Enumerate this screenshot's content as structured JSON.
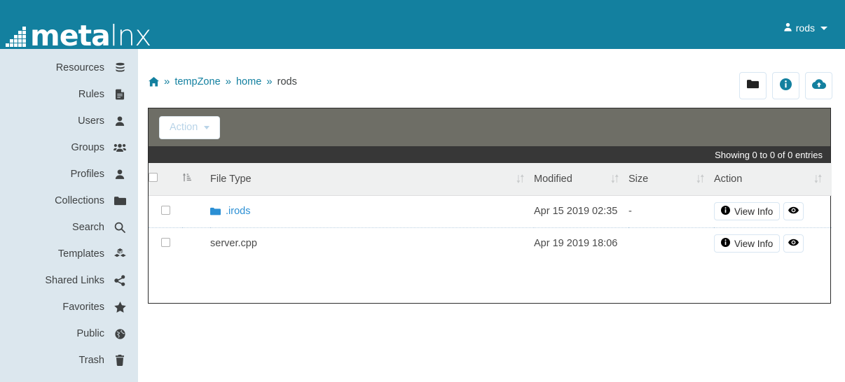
{
  "brand": {
    "name_bold": "meta",
    "name_light": "lnx",
    "header_color": "#13809f"
  },
  "header": {
    "user_label": "rods",
    "user_icon": "user-icon",
    "caret_icon": "caret-down-icon"
  },
  "sidebar": {
    "bg_color": "#dce7ee",
    "items": [
      {
        "label": "Resources",
        "icon": "database-icon"
      },
      {
        "label": "Rules",
        "icon": "file-text-icon"
      },
      {
        "label": "Users",
        "icon": "user-icon"
      },
      {
        "label": "Groups",
        "icon": "users-group-icon"
      },
      {
        "label": "Profiles",
        "icon": "user-icon"
      },
      {
        "label": "Collections",
        "icon": "folder-icon"
      },
      {
        "label": "Search",
        "icon": "search-icon"
      },
      {
        "label": "Templates",
        "icon": "cubes-icon"
      },
      {
        "label": "Shared Links",
        "icon": "share-icon"
      },
      {
        "label": "Favorites",
        "icon": "star-icon"
      },
      {
        "label": "Public",
        "icon": "globe-icon"
      },
      {
        "label": "Trash",
        "icon": "trash-icon"
      }
    ]
  },
  "breadcrumb": {
    "home_icon": "home-icon",
    "separator": "»",
    "items": [
      {
        "label": "tempZone",
        "link": true
      },
      {
        "label": "home",
        "link": true
      },
      {
        "label": "rods",
        "link": false
      }
    ]
  },
  "toolbar_buttons": [
    {
      "name": "new-folder-button",
      "icon": "folder-icon"
    },
    {
      "name": "info-button",
      "icon": "info-circle-icon"
    },
    {
      "name": "upload-button",
      "icon": "cloud-upload-icon"
    }
  ],
  "panel": {
    "action_button": {
      "label": "Action",
      "icon": "caret-down-icon",
      "disabled": true
    },
    "info_text": "Showing 0 to 0 of 0 entries",
    "toolbar_color": "#6e6e66",
    "info_bar_color": "#373737"
  },
  "table": {
    "columns": [
      {
        "key": "checkbox",
        "label": "",
        "sortable": false
      },
      {
        "key": "sort",
        "label": "",
        "sortable": true
      },
      {
        "key": "filetype",
        "label": "File Type",
        "sortable": true
      },
      {
        "key": "modified",
        "label": "Modified",
        "sortable": true
      },
      {
        "key": "size",
        "label": "Size",
        "sortable": true
      },
      {
        "key": "action",
        "label": "Action",
        "sortable": true
      }
    ],
    "rows": [
      {
        "name": ".irods",
        "is_folder": true,
        "modified": "Apr 15 2019 02:35",
        "size": "-",
        "actions": {
          "view_info": "View Info",
          "preview_icon": "eye-icon"
        }
      },
      {
        "name": "server.cpp",
        "is_folder": false,
        "modified": "Apr 19 2019 18:06",
        "size": "",
        "actions": {
          "view_info": "View Info",
          "preview_icon": "eye-icon"
        }
      }
    ]
  }
}
